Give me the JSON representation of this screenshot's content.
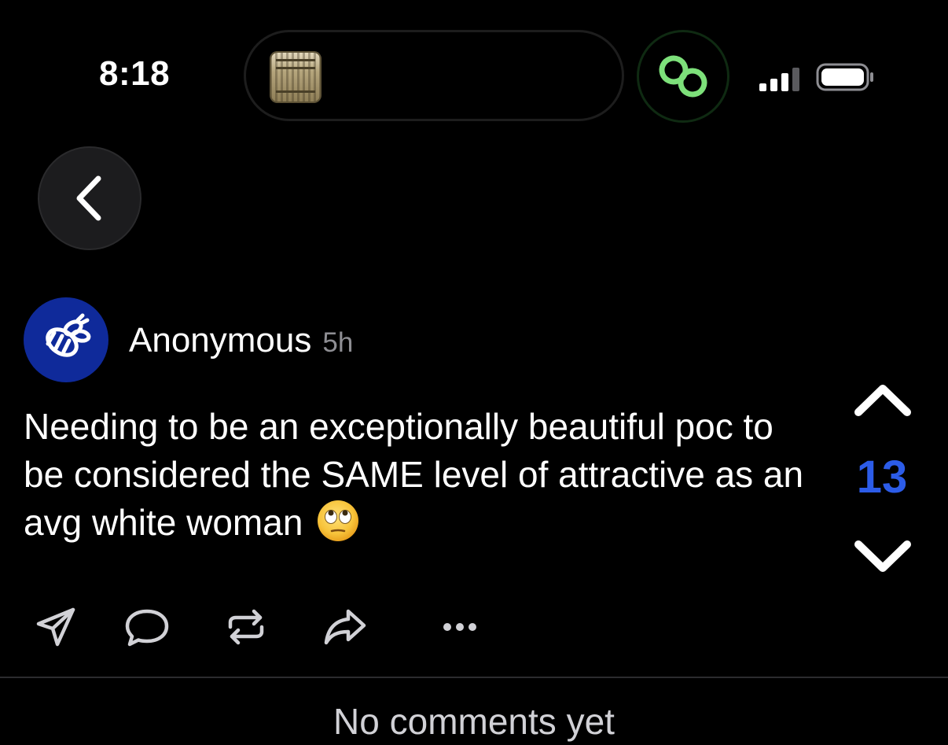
{
  "status_bar": {
    "time": "8:18"
  },
  "navigation": {
    "back_icon": "chevron-left-icon"
  },
  "post": {
    "author": "Anonymous",
    "time_ago": "5h",
    "avatar_icon": "bee-icon",
    "body": "Needing to be an exceptionally beautiful poc to be considered the SAME level of attractive as an avg white woman",
    "emoji": "face-with-rolling-eyes",
    "vote_count": "13"
  },
  "actions": [
    {
      "name": "send",
      "icon": "paper-plane-icon"
    },
    {
      "name": "comment",
      "icon": "speech-bubble-icon"
    },
    {
      "name": "repost",
      "icon": "repost-icon"
    },
    {
      "name": "share",
      "icon": "share-arrow-icon"
    },
    {
      "name": "more",
      "icon": "ellipsis-icon"
    }
  ],
  "comments": {
    "empty_text": "No comments yet"
  },
  "colors": {
    "background": "#000000",
    "vote_count": "#2c5ce8",
    "avatar": "#0f2a9a",
    "link_icon": "#7de07a"
  }
}
